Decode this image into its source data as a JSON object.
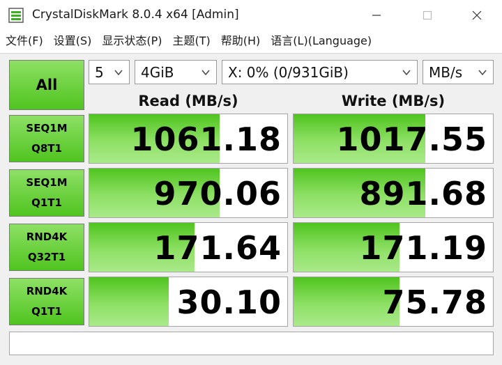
{
  "window": {
    "title": "CrystalDiskMark 8.0.4 x64 [Admin]",
    "app_icon": "crystaldiskmark-icon",
    "controls": [
      "minimize-icon",
      "maximize-icon",
      "close-icon"
    ]
  },
  "menu": [
    "文件(F)",
    "设置(S)",
    "显示状态(P)",
    "主题(T)",
    "帮助(H)",
    "语言(L)(Language)"
  ],
  "toolbar": {
    "all_label": "All",
    "count": "5",
    "size": "4GiB",
    "drive": "X: 0% (0/931GiB)",
    "unit": "MB/s"
  },
  "headers": {
    "read": "Read (MB/s)",
    "write": "Write (MB/s)"
  },
  "rows": [
    {
      "line1": "SEQ1M",
      "line2": "Q8T1",
      "read": "1061.18",
      "write": "1017.55",
      "read_fill": 0.66,
      "write_fill": 0.66
    },
    {
      "line1": "SEQ1M",
      "line2": "Q1T1",
      "read": "970.06",
      "write": "891.68",
      "read_fill": 0.66,
      "write_fill": 0.66
    },
    {
      "line1": "RND4K",
      "line2": "Q32T1",
      "read": "171.64",
      "write": "171.19",
      "read_fill": 0.53,
      "write_fill": 0.53
    },
    {
      "line1": "RND4K",
      "line2": "Q1T1",
      "read": "30.10",
      "write": "75.78",
      "read_fill": 0.4,
      "write_fill": 0.53
    }
  ],
  "comment": "",
  "colors": {
    "accent_green": "#4fc41f",
    "light_green": "#8ee065"
  }
}
